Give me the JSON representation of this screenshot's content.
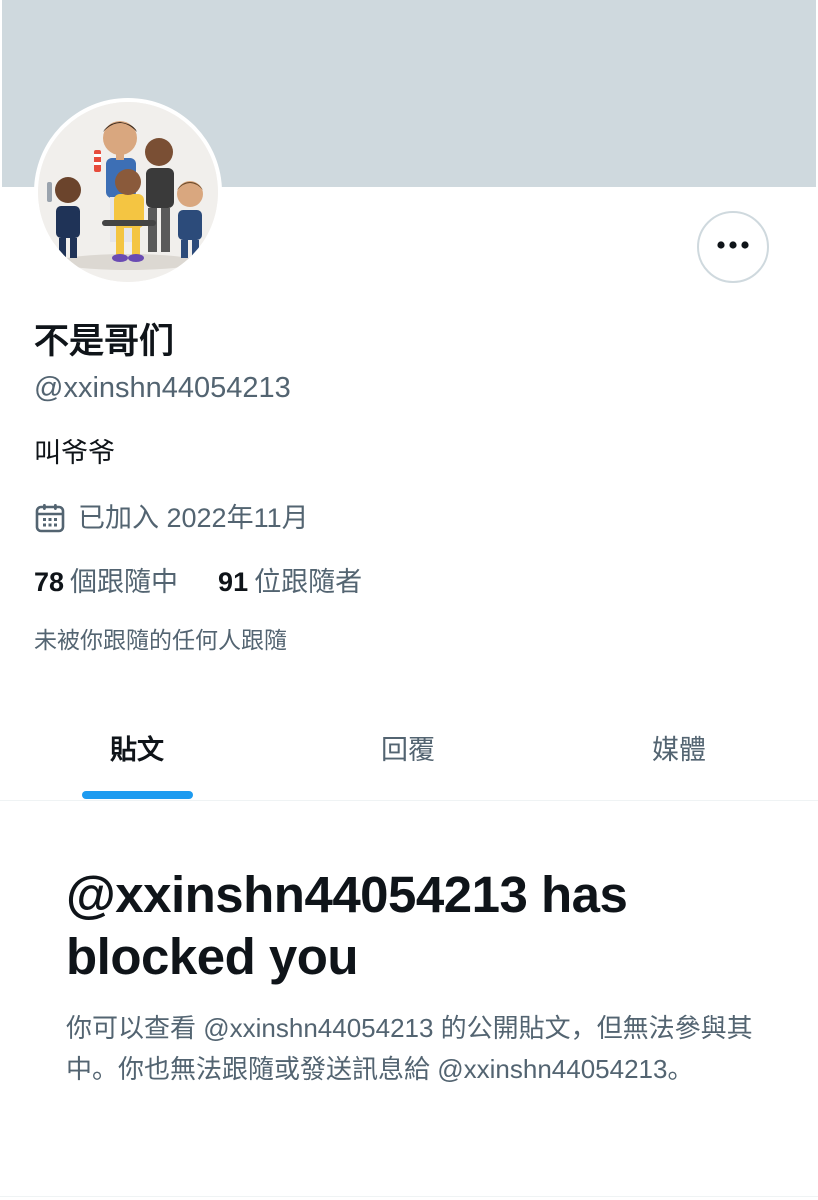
{
  "profile": {
    "display_name": "不是哥们",
    "handle": "@xxinshn44054213",
    "bio": "叫爷爷",
    "joined": "已加入 2022年11月",
    "following_count": "78",
    "following_label": "個跟隨中",
    "followers_count": "91",
    "followers_label": "位跟隨者",
    "followed_by": "未被你跟隨的任何人跟隨"
  },
  "icons": {
    "more": "more-horizontal-icon",
    "calendar": "calendar-icon"
  },
  "tabs": [
    {
      "label": "貼文",
      "active": true
    },
    {
      "label": "回覆",
      "active": false
    },
    {
      "label": "媒體",
      "active": false
    }
  ],
  "blocked": {
    "title": "@xxinshn44054213 has blocked you",
    "description": "你可以查看 @xxinshn44054213 的公開貼文，但無法參與其中。你也無法跟隨或發送訊息給 @xxinshn44054213。"
  },
  "colors": {
    "banner": "#cfd9de",
    "accent": "#1d9bf0",
    "text_primary": "#0f1419",
    "text_secondary": "#536471"
  }
}
